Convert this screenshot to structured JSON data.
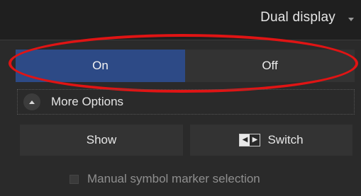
{
  "header": {
    "title": "Dual display"
  },
  "toggle": {
    "on_label": "On",
    "off_label": "Off",
    "selected": "On"
  },
  "more_options": {
    "label": "More Options"
  },
  "buttons": {
    "show_label": "Show",
    "switch_label": "Switch"
  },
  "checkbox": {
    "label": "Manual symbol marker selection",
    "checked": false
  },
  "icons": {
    "dropdown": "chevron-down-icon",
    "collapse": "chevron-up-icon",
    "switch": "swap-arrows-icon"
  },
  "colors": {
    "accent": "#2d4a86",
    "annotation": "#e01414"
  }
}
